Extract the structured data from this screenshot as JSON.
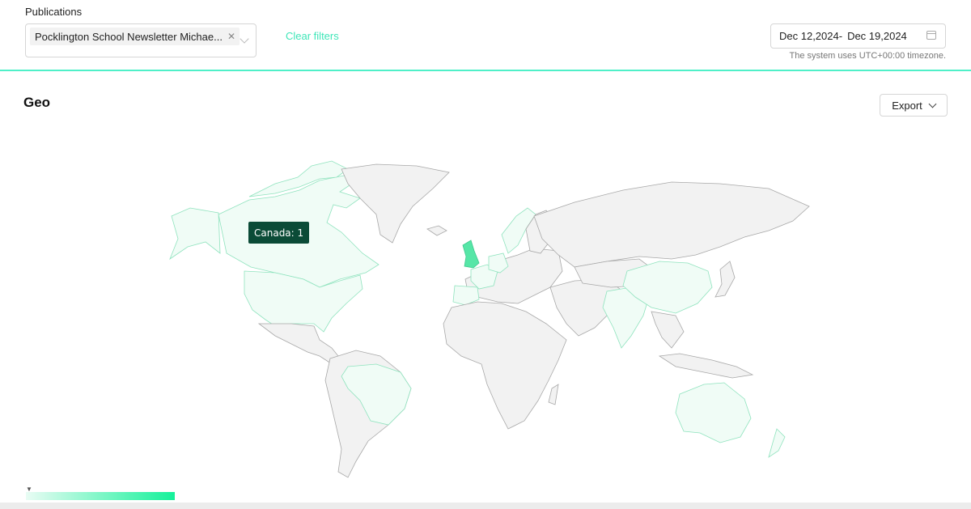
{
  "filters": {
    "publications_label": "Publications",
    "selected_publication": "Pocklington School Newsletter Michae...",
    "clear_filters_label": "Clear filters",
    "date_start": "Dec 12,2024-",
    "date_end": "Dec 19,2024",
    "timezone_note": "The system uses UTC+00:00 timezone."
  },
  "geo": {
    "title": "Geo",
    "export_label": "Export",
    "tooltip": "Canada: 1",
    "colors": {
      "accent": "#3ee6b8",
      "highlight_light": "#f0fcf6",
      "highlight_strong": "#56e6a7",
      "tooltip_bg": "#0b4b37"
    },
    "highlighted_countries": [
      "Canada",
      "United States",
      "United Kingdom",
      "France",
      "Spain",
      "Brazil",
      "China",
      "Australia",
      "Germany",
      "Norway",
      "India"
    ],
    "strong_country": "United Kingdom"
  }
}
